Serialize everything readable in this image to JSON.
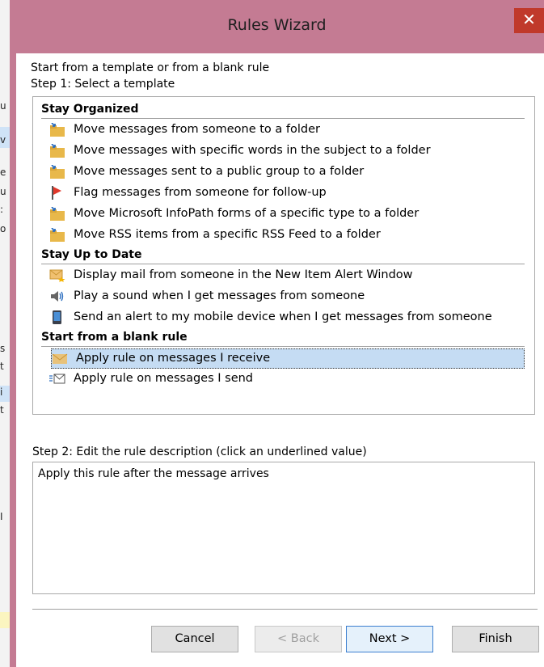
{
  "window": {
    "title": "Rules Wizard",
    "close_glyph": "✕"
  },
  "background_fragments": [
    "u",
    "v",
    "e",
    "u",
    ":",
    "o",
    "s",
    "t",
    "i",
    "t",
    "I"
  ],
  "heading": "Start from a template or from a blank rule",
  "step1_label": "Step 1: Select a template",
  "groups": [
    {
      "label": "Stay Organized",
      "items": [
        {
          "icon": "move-folder-icon",
          "label": "Move messages from someone to a folder"
        },
        {
          "icon": "move-folder-icon",
          "label": "Move messages with specific words in the subject to a folder"
        },
        {
          "icon": "move-folder-icon",
          "label": "Move messages sent to a public group to a folder"
        },
        {
          "icon": "red-flag-icon",
          "label": "Flag messages from someone for follow-up"
        },
        {
          "icon": "move-folder-icon",
          "label": "Move Microsoft InfoPath forms of a specific type to a folder"
        },
        {
          "icon": "move-folder-icon",
          "label": "Move RSS items from a specific RSS Feed to a folder"
        }
      ]
    },
    {
      "label": "Stay Up to Date",
      "items": [
        {
          "icon": "new-item-alert-icon",
          "label": "Display mail from someone in the New Item Alert Window"
        },
        {
          "icon": "speaker-icon",
          "label": "Play a sound when I get messages from someone"
        },
        {
          "icon": "mobile-device-icon",
          "label": "Send an alert to my mobile device when I get messages from someone"
        }
      ]
    },
    {
      "label": "Start from a blank rule",
      "items": [
        {
          "icon": "receive-envelope-icon",
          "label": "Apply rule on messages I receive",
          "selected": true
        },
        {
          "icon": "send-envelope-icon",
          "label": "Apply rule on messages I send"
        }
      ]
    }
  ],
  "step2_label": "Step 2: Edit the rule description (click an underlined value)",
  "description_text": "Apply this rule after the message arrives",
  "buttons": {
    "cancel": "Cancel",
    "back": "< Back",
    "next": "Next >",
    "finish": "Finish"
  },
  "colors": {
    "titlebar": "#c47b93",
    "close": "#c0392b",
    "selection": "#c5dcf3",
    "default_button_border": "#3c7fd0"
  }
}
